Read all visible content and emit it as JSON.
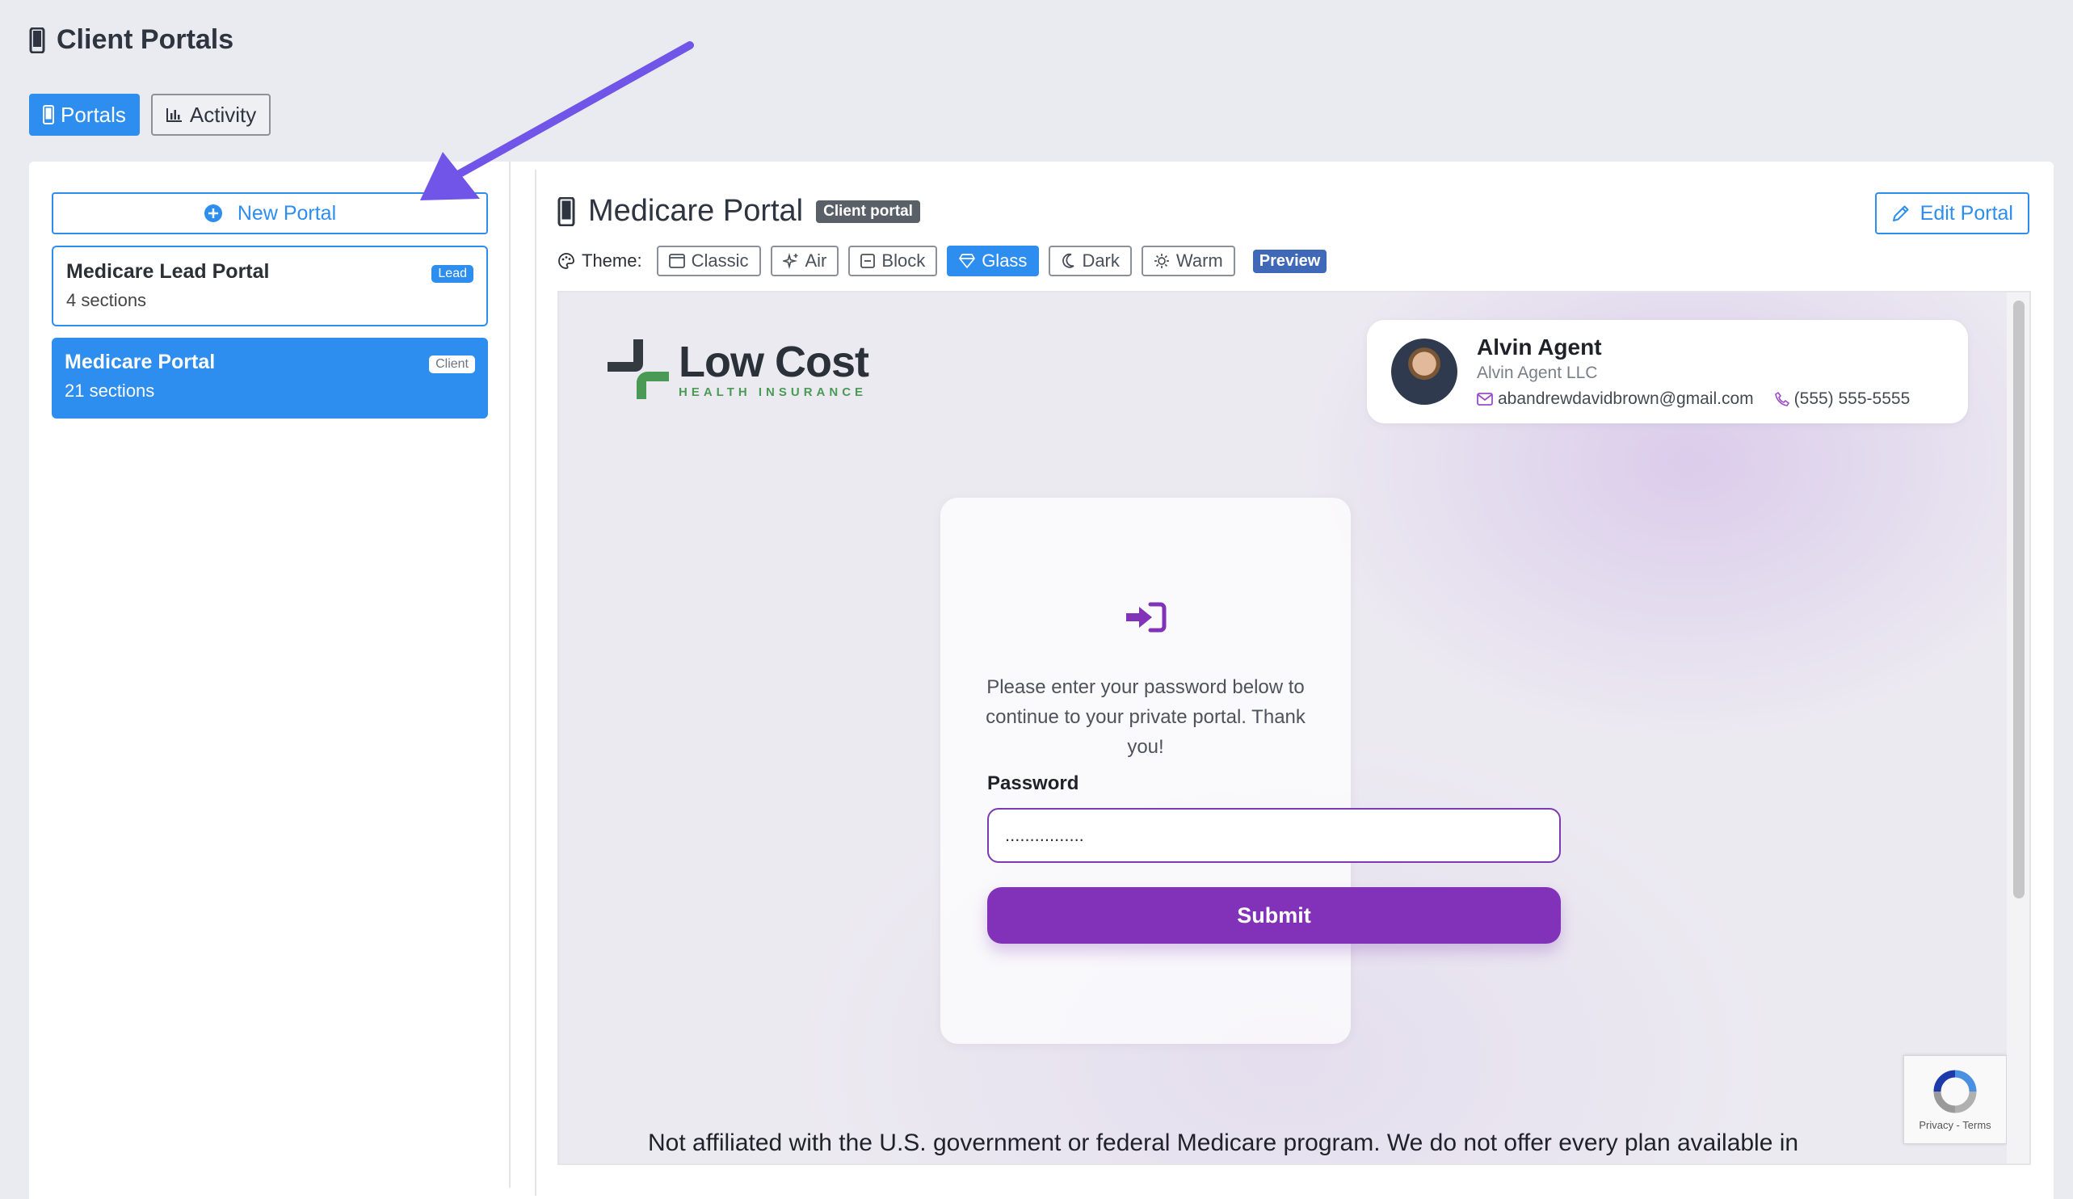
{
  "header": {
    "title": "Client Portals",
    "icon": "phone-icon"
  },
  "tabs": [
    {
      "label": "Portals",
      "icon": "phone-icon",
      "active": true
    },
    {
      "label": "Activity",
      "icon": "bar-chart-icon",
      "active": false
    }
  ],
  "sidebar": {
    "new_portal_label": "New Portal",
    "portals": [
      {
        "name": "Medicare Lead Portal",
        "sections": "4 sections",
        "badge": "Lead",
        "selected": false
      },
      {
        "name": "Medicare Portal",
        "sections": "21 sections",
        "badge": "Client",
        "selected": true
      }
    ]
  },
  "detail": {
    "title": "Medicare Portal",
    "badge": "Client portal",
    "edit_label": "Edit Portal",
    "theme_label": "Theme:",
    "themes": [
      {
        "label": "Classic",
        "icon": "window-icon",
        "active": false
      },
      {
        "label": "Air",
        "icon": "sparkle-icon",
        "active": false
      },
      {
        "label": "Block",
        "icon": "block-icon",
        "active": false
      },
      {
        "label": "Glass",
        "icon": "diamond-icon",
        "active": true
      },
      {
        "label": "Dark",
        "icon": "moon-icon",
        "active": false
      },
      {
        "label": "Warm",
        "icon": "sun-icon",
        "active": false
      }
    ],
    "preview_badge": "Preview"
  },
  "preview": {
    "logo_main": "Low Cost",
    "logo_sub": "HEALTH INSURANCE",
    "agent": {
      "name": "Alvin Agent",
      "company": "Alvin Agent LLC",
      "email": "abandrewdavidbrown@gmail.com",
      "phone": "(555) 555-5555"
    },
    "login": {
      "message": "Please enter your password below to continue to your private portal. Thank you!",
      "password_label": "Password",
      "password_value": "................",
      "submit_label": "Submit"
    },
    "disclaimer": "Not affiliated with the U.S. government or federal Medicare program. We do not offer every plan available in",
    "recaptcha_links": "Privacy - Terms"
  },
  "colors": {
    "accent": "#2d8ef0",
    "purple": "#8132b8",
    "arrow": "#7155e8"
  }
}
